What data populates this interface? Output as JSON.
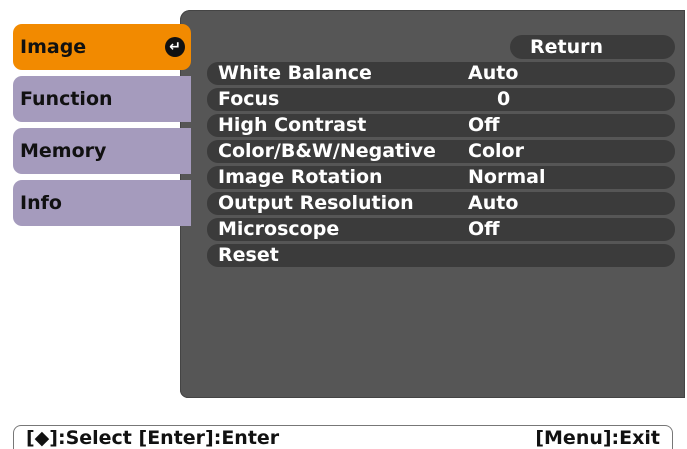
{
  "tabs": [
    {
      "label": "Image",
      "active": true,
      "icon": "enter-icon"
    },
    {
      "label": "Function",
      "active": false
    },
    {
      "label": "Memory",
      "active": false
    },
    {
      "label": "Info",
      "active": false
    }
  ],
  "tab_enter_glyph": "↵",
  "return_label": "Return",
  "menu_items": [
    {
      "label": "White Balance",
      "value": "Auto"
    },
    {
      "label": "Focus",
      "value": "0"
    },
    {
      "label": "High Contrast",
      "value": "Off"
    },
    {
      "label": "Color/B&W/Negative",
      "value": "Color"
    },
    {
      "label": "Image Rotation",
      "value": "Normal"
    },
    {
      "label": "Output Resolution",
      "value": "Auto"
    },
    {
      "label": "Microscope",
      "value": "Off"
    },
    {
      "label": "Reset",
      "value": ""
    }
  ],
  "helpbar": {
    "left": "[◆]:Select  [Enter]:Enter",
    "right": "[Menu]:Exit"
  },
  "colors": {
    "panel": "#565656",
    "row": "#3b3b3b",
    "tab_inactive": "#a59bbd",
    "tab_active": "#f28a00"
  }
}
